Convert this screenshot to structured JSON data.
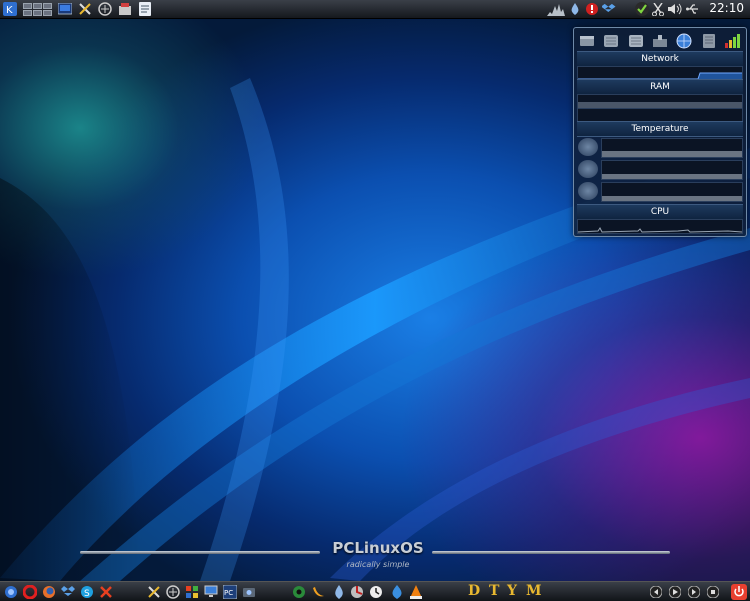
{
  "top_panel": {
    "launcher_icon": "kde-menu-icon",
    "pager_desktops": 6,
    "clock": "22:10",
    "left_icons": [
      "terminal-icon",
      "tools-icon",
      "network-manager-icon",
      "package-icon",
      "notes-icon"
    ],
    "tray_icons": [
      "system-load-icon",
      "drop-icon",
      "alert-icon",
      "dropbox-icon",
      "check-icon",
      "scissors-icon",
      "volume-icon",
      "usb-icon"
    ]
  },
  "monitor": {
    "sections": {
      "network": "Network",
      "ram": "RAM",
      "temperature": "Temperature",
      "cpu": "CPU"
    },
    "header_icons": [
      "drive-icon",
      "disk-icon",
      "disk2-icon",
      "sensors-icon",
      "globe-icon",
      "memory-icon",
      "signal-icon"
    ]
  },
  "branding": {
    "title": "PCLinuxOS",
    "tagline": "radically simple"
  },
  "bottom_panel": {
    "left_icons": [
      "network-icon",
      "opera-icon",
      "firefox-icon",
      "dropbox-icon",
      "skype-icon",
      "tools-icon"
    ],
    "mid_icons": [
      "settings-icon",
      "network-manager-icon",
      "windows-icon",
      "monitor-icon",
      "pclinuxos-icon",
      "screenshot-icon"
    ],
    "media_icons": [
      "speaker-icon",
      "banana-icon",
      "drop-icon",
      "disk-utility-icon",
      "clock-icon",
      "droplet-icon",
      "vlc-icon"
    ],
    "letters": [
      "D",
      "T",
      "Y",
      "M"
    ],
    "player_icons": [
      "prev-icon",
      "play-icon",
      "next-icon",
      "stop-icon"
    ],
    "power_icon": "power-icon"
  },
  "colors": {
    "panel": "#1d2127",
    "accent": "#e8b830",
    "graph_line": "#2a6fd0"
  }
}
